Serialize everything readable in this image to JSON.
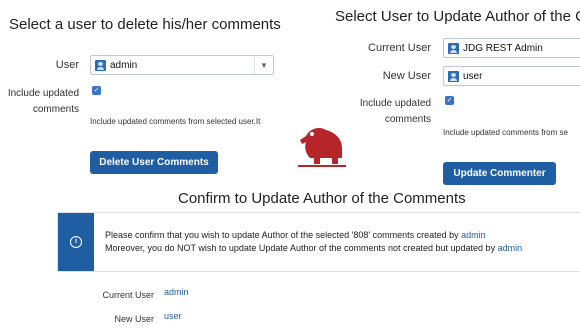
{
  "left_form": {
    "title": "Select a user to delete his/her comments",
    "user_label": "User",
    "user_value": "admin",
    "include_label_line1": "Include updated",
    "include_label_line2": "comments",
    "include_checked": true,
    "include_hint": "Include updated comments from selected user.It",
    "delete_button": "Delete User Comments"
  },
  "right_form": {
    "title": "Select User to Update Author of the C",
    "current_user_label": "Current User",
    "current_user_value": "JDG REST Admin",
    "new_user_label": "New User",
    "new_user_value": "user",
    "include_label_line1": "Include updated",
    "include_label_line2": "comments",
    "include_checked": true,
    "include_hint": "Include updated comments from se",
    "update_button": "Update Commenter"
  },
  "confirm": {
    "title": "Confirm to Update Author of the Comments",
    "line1_text": "Please confirm that you wish to update Author of the selected '808' comments created by",
    "line1_user": "admin",
    "line2_text": "Moreover, you do NOT wish to update Update Author of the comments not created but updated by",
    "line2_user": "admin",
    "current_user_label": "Current User",
    "current_user_value": "admin",
    "new_user_label": "New User",
    "new_user_value": "user"
  },
  "icons": {
    "avatar": "user-avatar-icon",
    "dropdown": "chevron-down-icon",
    "info": "info-icon",
    "logo": "mascot-logo"
  },
  "colors": {
    "primary": "#205ea3",
    "logo": "#b5252a"
  }
}
